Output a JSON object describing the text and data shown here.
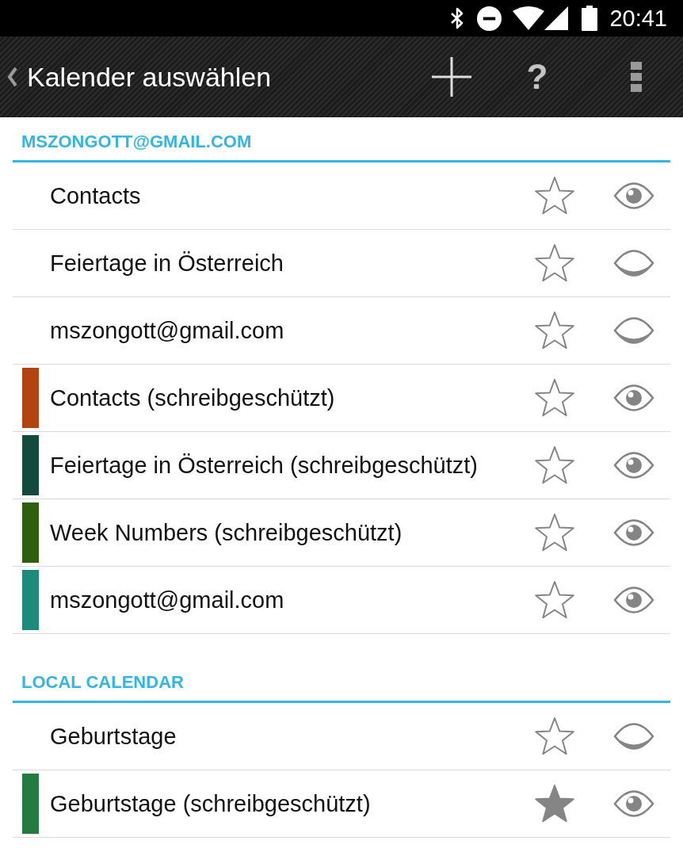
{
  "status_bar": {
    "time": "20:41"
  },
  "action_bar": {
    "title": "Kalender auswählen",
    "help_label": "?"
  },
  "sections": [
    {
      "header": "MSZONGOTT@GMAIL.COM",
      "calendars": [
        {
          "name": "Contacts",
          "starred": false,
          "visible": true
        },
        {
          "name": "Feiertage in Österreich",
          "starred": false,
          "visible": false
        },
        {
          "name": "mszongott@gmail.com",
          "starred": false,
          "visible": false
        },
        {
          "name": "Contacts (schreibgeschützt)",
          "color": "#b34410",
          "starred": false,
          "visible": true
        },
        {
          "name": "Feiertage in Österreich (schreibgeschützt)",
          "color": "#134a3b",
          "starred": false,
          "visible": true
        },
        {
          "name": "Week Numbers (schreibgeschützt)",
          "color": "#2f5f0c",
          "starred": false,
          "visible": true
        },
        {
          "name": "mszongott@gmail.com",
          "color": "#1e8a79",
          "starred": false,
          "visible": true
        }
      ]
    },
    {
      "header": "LOCAL CALENDAR",
      "calendars": [
        {
          "name": "Geburtstage",
          "starred": false,
          "visible": false
        },
        {
          "name": "Geburtstage (schreibgeschützt)",
          "color": "#247b41",
          "starred": true,
          "visible": true
        }
      ]
    }
  ]
}
